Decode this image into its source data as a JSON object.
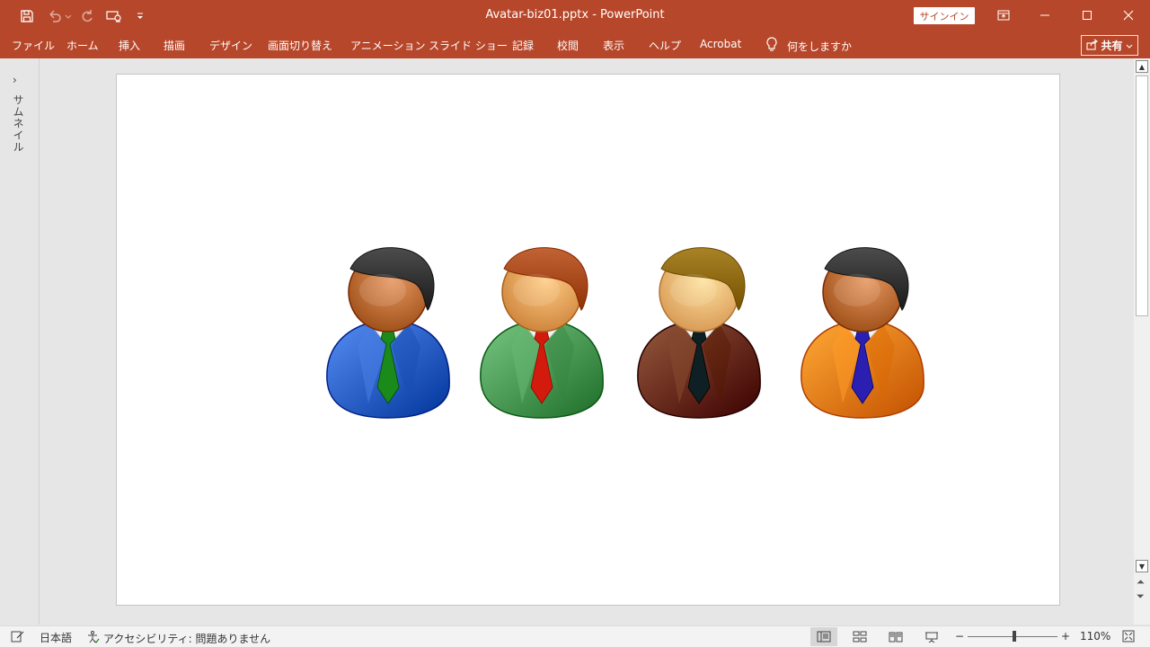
{
  "window": {
    "title": "Avatar-biz01.pptx  -  PowerPoint",
    "signin_label": "サインイン",
    "qat_icons": [
      "save-icon",
      "undo-icon",
      "redo-icon",
      "touch-mode-icon",
      "customize-qat-icon"
    ],
    "window_controls": [
      "ribbon-display-icon",
      "minimize-icon",
      "maximize-icon",
      "close-icon"
    ]
  },
  "ribbon": {
    "tabs": [
      "ファイル",
      "ホーム",
      "挿入",
      "描画",
      "デザイン",
      "画面切り替え",
      "アニメーション",
      "スライド ショー",
      "記録",
      "校閲",
      "表示",
      "ヘルプ",
      "Acrobat"
    ],
    "tell_me": "何をしますか",
    "share_label": "共有"
  },
  "rail": {
    "label": "サムネイル",
    "toggle_glyph": "›"
  },
  "slide": {
    "avatars": [
      {
        "name": "avatar-blue-suit",
        "hair": "#2e2e2e",
        "skin": "#b5652e",
        "suit": "#2f66cc",
        "tie": "#1a8a1a"
      },
      {
        "name": "avatar-green-suit",
        "hair": "#a34516",
        "skin": "#e59a52",
        "suit": "#4f9f5a",
        "tie": "#d21b0c"
      },
      {
        "name": "avatar-brown-suit",
        "hair": "#8a6508",
        "skin": "#efb06c",
        "suit": "#6e3115",
        "tie": "#0e2024"
      },
      {
        "name": "avatar-orange-suit",
        "hair": "#2e2e2e",
        "skin": "#b5652e",
        "suit": "#f5820e",
        "tie": "#2a1fb0"
      }
    ]
  },
  "status": {
    "language": "日本語",
    "accessibility": "アクセシビリティ: 問題ありません",
    "zoom_level": "110%",
    "zoom_fraction": 0.52,
    "views": [
      "normal-view-icon",
      "slide-sorter-icon",
      "reading-view-icon",
      "slideshow-icon"
    ]
  },
  "colors": {
    "accent": "#b7472a"
  }
}
